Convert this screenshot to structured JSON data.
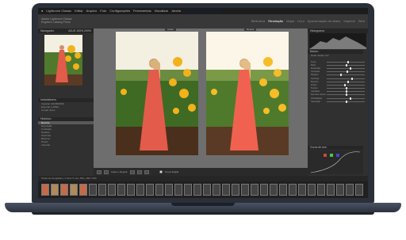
{
  "app": {
    "title": "Adobe Photoshop Lightroom Classic - Revelação"
  },
  "menubar": [
    "Lightroom Classic",
    "Editar",
    "Arquivo",
    "Foto",
    "Configurações",
    "Ferramentas",
    "Visualizar",
    "Janela",
    "Ajuda"
  ],
  "identity": {
    "line1": "Adobe Lightroom Classic",
    "line2": "Engeta's Catalog Photo"
  },
  "modules": [
    {
      "label": "Biblioteca",
      "active": false
    },
    {
      "label": "Revelação",
      "active": true
    },
    {
      "label": "Mapa",
      "active": false
    },
    {
      "label": "Livro",
      "active": false
    },
    {
      "label": "Apresentação de slides",
      "active": false
    },
    {
      "label": "Imprimir",
      "active": false
    },
    {
      "label": "Web",
      "active": false
    }
  ],
  "left_panel": {
    "navigator": "Navegador",
    "navigator_fit": "AJUS  100%  200%",
    "snapshots": "Instantâneos",
    "snapshot_items": [
      "Importar (01/08/2023)",
      "Exportar a JPEG",
      "Limpar antes"
    ],
    "history": "Histórico",
    "history_items": [
      "Recorte",
      "Exposição",
      "Contraste",
      "Realces",
      "Sombras",
      "Brancos",
      "Pretos",
      "Importar"
    ],
    "copy_label": "Copiar...",
    "paste_label": "Colar"
  },
  "center": {
    "before_label": "Antes",
    "after_label": "Depois"
  },
  "toolbar": {
    "before_after": "Antes e Depois:",
    "soft_proof": "Prova Digital"
  },
  "right_panel": {
    "histogram": "Histograma",
    "basic": "Básico",
    "profile": "Perfil: Adobe Cor",
    "sliders": [
      {
        "label": "Temp.",
        "value": 0.55
      },
      {
        "label": "Matiz",
        "value": 0.5
      },
      {
        "label": "Exposição",
        "value": 0.6
      },
      {
        "label": "Contraste",
        "value": 0.52
      },
      {
        "label": "Realces",
        "value": 0.35
      },
      {
        "label": "Sombras",
        "value": 0.65
      },
      {
        "label": "Brancos",
        "value": 0.55
      },
      {
        "label": "Pretos",
        "value": 0.45
      },
      {
        "label": "Textura",
        "value": 0.5
      },
      {
        "label": "Claridade",
        "value": 0.5
      },
      {
        "label": "Remover névoa",
        "value": 0.5
      },
      {
        "label": "Vibratilidade",
        "value": 0.6
      },
      {
        "label": "Saturação",
        "value": 0.5
      }
    ],
    "tone_curve": "Curva de tom",
    "previous_label": "Anterior",
    "reset_label": "Redefinir"
  },
  "filmstrip": {
    "info": "Todas as fotografias  |  1 fotos /1 sel  |  IMG_1867.CR3",
    "frames": 34
  },
  "colors": {
    "dress": "#e35b4a",
    "foliage": "#4f7a2c",
    "sunflower": "#f2b21a",
    "sky": "#f3efe1"
  }
}
